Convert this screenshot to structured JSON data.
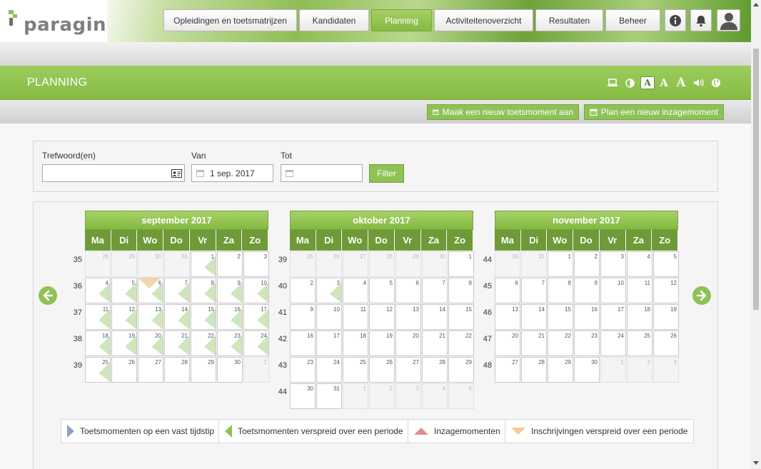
{
  "brand": {
    "logo_text": "paragin"
  },
  "nav": [
    {
      "label": "Opleidingen en toetsmatrijzen",
      "active": false
    },
    {
      "label": "Kandidaten",
      "active": false
    },
    {
      "label": "Planning",
      "active": true
    },
    {
      "label": "Activiteitenoverzicht",
      "active": false
    },
    {
      "label": "Resultaten",
      "active": false
    },
    {
      "label": "Beheer",
      "active": false
    }
  ],
  "page_title": "PLANNING",
  "actions": {
    "new_test": "Maak een nieuw toetsmoment aan",
    "new_review": "Plan een nieuw inzagemoment"
  },
  "filter": {
    "keyword_label": "Trefwoord(en)",
    "keyword_value": "",
    "from_label": "Van",
    "from_value": "1 sep. 2017",
    "to_label": "Tot",
    "to_value": "",
    "button": "Filter"
  },
  "weekday_labels": [
    "Ma",
    "Di",
    "Wo",
    "Do",
    "Vr",
    "Za",
    "Zo"
  ],
  "calendars": [
    {
      "title": "september 2017",
      "weeks": [
        {
          "wn": "35",
          "days": [
            [
              "28",
              1,
              ""
            ],
            [
              "29",
              1,
              ""
            ],
            [
              "30",
              1,
              ""
            ],
            [
              "31",
              1,
              ""
            ],
            [
              "1",
              0,
              "g"
            ],
            [
              "2",
              0,
              ""
            ],
            [
              "3",
              0,
              ""
            ]
          ]
        },
        {
          "wn": "36",
          "days": [
            [
              "4",
              0,
              "g"
            ],
            [
              "5",
              0,
              "g"
            ],
            [
              "6",
              0,
              "go"
            ],
            [
              "7",
              0,
              "g"
            ],
            [
              "8",
              0,
              "g"
            ],
            [
              "9",
              0,
              "g"
            ],
            [
              "10",
              0,
              "g"
            ]
          ]
        },
        {
          "wn": "37",
          "days": [
            [
              "11",
              0,
              "g"
            ],
            [
              "12",
              0,
              "g"
            ],
            [
              "13",
              0,
              "g"
            ],
            [
              "14",
              0,
              "g"
            ],
            [
              "15",
              0,
              "g"
            ],
            [
              "16",
              0,
              "g"
            ],
            [
              "17",
              0,
              "g"
            ]
          ]
        },
        {
          "wn": "38",
          "days": [
            [
              "18",
              0,
              "g"
            ],
            [
              "19",
              0,
              "g"
            ],
            [
              "20",
              0,
              "g"
            ],
            [
              "21",
              0,
              "g"
            ],
            [
              "22",
              0,
              "g"
            ],
            [
              "23",
              0,
              "g"
            ],
            [
              "24",
              0,
              "g"
            ]
          ]
        },
        {
          "wn": "39",
          "days": [
            [
              "25",
              0,
              "g"
            ],
            [
              "26",
              0,
              ""
            ],
            [
              "27",
              0,
              ""
            ],
            [
              "28",
              0,
              ""
            ],
            [
              "29",
              0,
              ""
            ],
            [
              "30",
              0,
              ""
            ],
            [
              "1",
              1,
              ""
            ]
          ]
        }
      ]
    },
    {
      "title": "oktober 2017",
      "weeks": [
        {
          "wn": "39",
          "days": [
            [
              "25",
              1,
              ""
            ],
            [
              "26",
              1,
              ""
            ],
            [
              "27",
              1,
              ""
            ],
            [
              "28",
              1,
              ""
            ],
            [
              "29",
              1,
              ""
            ],
            [
              "30",
              1,
              ""
            ],
            [
              "1",
              0,
              ""
            ]
          ]
        },
        {
          "wn": "40",
          "days": [
            [
              "2",
              0,
              ""
            ],
            [
              "3",
              0,
              "g"
            ],
            [
              "4",
              0,
              ""
            ],
            [
              "5",
              0,
              ""
            ],
            [
              "6",
              0,
              ""
            ],
            [
              "7",
              0,
              ""
            ],
            [
              "8",
              0,
              ""
            ]
          ]
        },
        {
          "wn": "41",
          "days": [
            [
              "9",
              0,
              ""
            ],
            [
              "10",
              0,
              ""
            ],
            [
              "11",
              0,
              ""
            ],
            [
              "12",
              0,
              ""
            ],
            [
              "13",
              0,
              ""
            ],
            [
              "14",
              0,
              ""
            ],
            [
              "15",
              0,
              ""
            ]
          ]
        },
        {
          "wn": "42",
          "days": [
            [
              "16",
              0,
              ""
            ],
            [
              "17",
              0,
              ""
            ],
            [
              "18",
              0,
              ""
            ],
            [
              "19",
              0,
              ""
            ],
            [
              "20",
              0,
              ""
            ],
            [
              "21",
              0,
              ""
            ],
            [
              "22",
              0,
              ""
            ]
          ]
        },
        {
          "wn": "43",
          "days": [
            [
              "23",
              0,
              ""
            ],
            [
              "24",
              0,
              ""
            ],
            [
              "25",
              0,
              ""
            ],
            [
              "26",
              0,
              ""
            ],
            [
              "27",
              0,
              ""
            ],
            [
              "28",
              0,
              ""
            ],
            [
              "29",
              0,
              ""
            ]
          ]
        },
        {
          "wn": "44",
          "days": [
            [
              "30",
              0,
              ""
            ],
            [
              "31",
              0,
              ""
            ],
            [
              "1",
              1,
              ""
            ],
            [
              "2",
              1,
              ""
            ],
            [
              "3",
              1,
              ""
            ],
            [
              "4",
              1,
              ""
            ],
            [
              "5",
              1,
              ""
            ]
          ]
        }
      ]
    },
    {
      "title": "november 2017",
      "weeks": [
        {
          "wn": "44",
          "days": [
            [
              "30",
              1,
              ""
            ],
            [
              "31",
              1,
              ""
            ],
            [
              "1",
              0,
              ""
            ],
            [
              "2",
              0,
              ""
            ],
            [
              "3",
              0,
              ""
            ],
            [
              "4",
              0,
              ""
            ],
            [
              "5",
              0,
              ""
            ]
          ]
        },
        {
          "wn": "45",
          "days": [
            [
              "6",
              0,
              ""
            ],
            [
              "7",
              0,
              ""
            ],
            [
              "8",
              0,
              ""
            ],
            [
              "9",
              0,
              ""
            ],
            [
              "10",
              0,
              ""
            ],
            [
              "11",
              0,
              ""
            ],
            [
              "12",
              0,
              ""
            ]
          ]
        },
        {
          "wn": "46",
          "days": [
            [
              "13",
              0,
              ""
            ],
            [
              "14",
              0,
              ""
            ],
            [
              "15",
              0,
              ""
            ],
            [
              "16",
              0,
              ""
            ],
            [
              "17",
              0,
              ""
            ],
            [
              "18",
              0,
              ""
            ],
            [
              "19",
              0,
              ""
            ]
          ]
        },
        {
          "wn": "47",
          "days": [
            [
              "20",
              0,
              ""
            ],
            [
              "21",
              0,
              ""
            ],
            [
              "22",
              0,
              ""
            ],
            [
              "23",
              0,
              ""
            ],
            [
              "24",
              0,
              ""
            ],
            [
              "25",
              0,
              ""
            ],
            [
              "26",
              0,
              ""
            ]
          ]
        },
        {
          "wn": "48",
          "days": [
            [
              "27",
              0,
              ""
            ],
            [
              "28",
              0,
              ""
            ],
            [
              "29",
              0,
              ""
            ],
            [
              "30",
              0,
              ""
            ],
            [
              "1",
              1,
              ""
            ],
            [
              "2",
              1,
              ""
            ],
            [
              "3",
              1,
              ""
            ]
          ]
        }
      ]
    }
  ],
  "legend": [
    {
      "label": "Toetsmomenten op een vast tijdstip",
      "color": "#8aa2c8",
      "icon": "triangle-right-icon"
    },
    {
      "label": "Toetsmomenten verspreid over een periode",
      "color": "#8ec255",
      "icon": "triangle-left-icon"
    },
    {
      "label": "Inzagemomenten",
      "color": "#e08f8f",
      "icon": "triangle-up-icon"
    },
    {
      "label": "Inschrijvingen verspreid over een periode",
      "color": "#f6c98e",
      "icon": "triangle-down-icon"
    }
  ]
}
